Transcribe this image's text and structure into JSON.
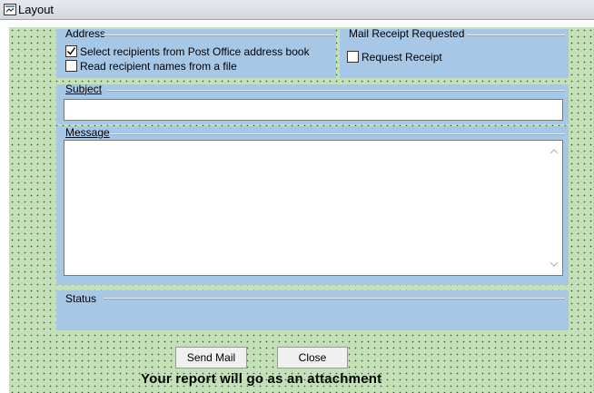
{
  "window": {
    "title": "Layout"
  },
  "address": {
    "title": "Address",
    "option1": {
      "label": "Select recipients from Post Office address book",
      "checked": true
    },
    "option2": {
      "label": "Read recipient names from a file",
      "checked": false
    }
  },
  "receipt": {
    "title": "Mail Receipt Requested",
    "option": {
      "label": "Request Receipt",
      "checked": false
    }
  },
  "subject": {
    "title": "Subject",
    "value": ""
  },
  "message": {
    "title": "Message",
    "value": ""
  },
  "status": {
    "title": "Status"
  },
  "buttons": {
    "send": "Send Mail",
    "close": "Close"
  },
  "footer": {
    "text": "Your report will go as an attachment"
  },
  "colors": {
    "form_bg": "#c4e0b8",
    "panel_bg": "#a7c7e6"
  }
}
